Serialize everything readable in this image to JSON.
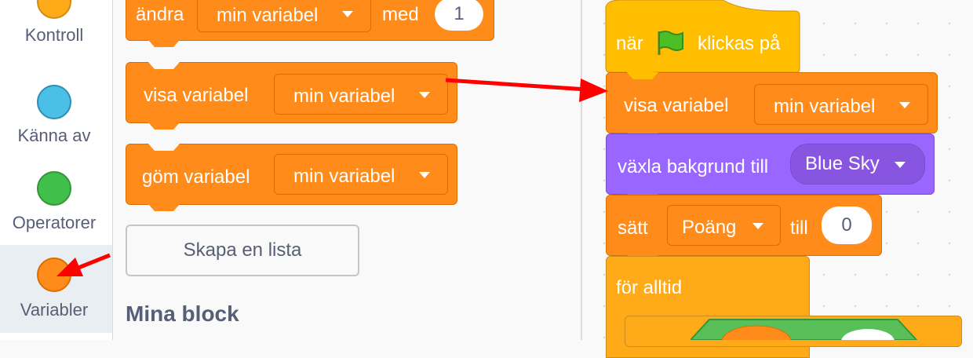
{
  "categories": [
    {
      "label": "Kontroll",
      "color": "#ffab19",
      "border": "#cf8b17",
      "selected": false
    },
    {
      "label": "Känna av",
      "color": "#4cbfe6",
      "border": "#2e8eb8",
      "selected": false
    },
    {
      "label": "Operatorer",
      "color": "#40bf4a",
      "border": "#389438",
      "selected": false
    },
    {
      "label": "Variabler",
      "color": "#ff8c1a",
      "border": "#db6e00",
      "selected": true
    }
  ],
  "palette": {
    "change_block": {
      "prefix": "ändra",
      "variable": "min variabel",
      "middle": "med",
      "value": "1"
    },
    "show_block": {
      "prefix": "visa variabel",
      "variable": "min variabel"
    },
    "hide_block": {
      "prefix": "göm variabel",
      "variable": "min variabel"
    },
    "make_list_button": "Skapa en lista",
    "my_blocks_heading": "Mina block"
  },
  "script": {
    "hat": {
      "prefix": "när",
      "icon": "green-flag-icon",
      "suffix": "klickas på"
    },
    "show_block": {
      "prefix": "visa variabel",
      "variable": "min variabel"
    },
    "backdrop_block": {
      "prefix": "växla bakgrund till",
      "value": "Blue Sky"
    },
    "set_block": {
      "prefix": "sätt",
      "variable": "Poäng",
      "middle": "till",
      "value": "0"
    },
    "forever_block": {
      "label": "för alltid"
    }
  },
  "colors": {
    "variables": "#ff8c1a",
    "control": "#ffab19",
    "looks": "#9966ff",
    "operators": "#59c059",
    "annotation_arrow": "#ff0000"
  }
}
